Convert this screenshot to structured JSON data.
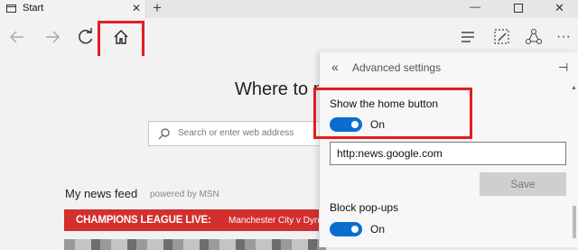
{
  "tab": {
    "title": "Start",
    "close": "✕"
  },
  "tabstrip": {
    "new_tab": "+",
    "minimize": "—",
    "close": "✕"
  },
  "page": {
    "headline": "Where to n",
    "search_placeholder": "Search or enter web address",
    "news_feed": "My news feed",
    "powered_by": "powered by MSN",
    "banner_bold": "CHAMPIONS LEAGUE LIVE:",
    "banner_rest": "Manchester City v Dynan"
  },
  "panel": {
    "back": "«",
    "title": "Advanced settings",
    "pin": "⊣",
    "home_label": "Show the home button",
    "home_toggle": "On",
    "home_url": "http:news.google.com",
    "save": "Save",
    "popups_label": "Block pop-ups",
    "popups_toggle": "On"
  },
  "colors": {
    "accent": "#0a6ed1",
    "highlight": "#e51c23",
    "banner": "#d32f2f"
  },
  "icons": [
    "back-arrow-icon",
    "forward-arrow-icon",
    "refresh-icon",
    "home-icon",
    "hub-icon",
    "web-note-icon",
    "share-icon",
    "search-icon",
    "tab-page-icon"
  ]
}
